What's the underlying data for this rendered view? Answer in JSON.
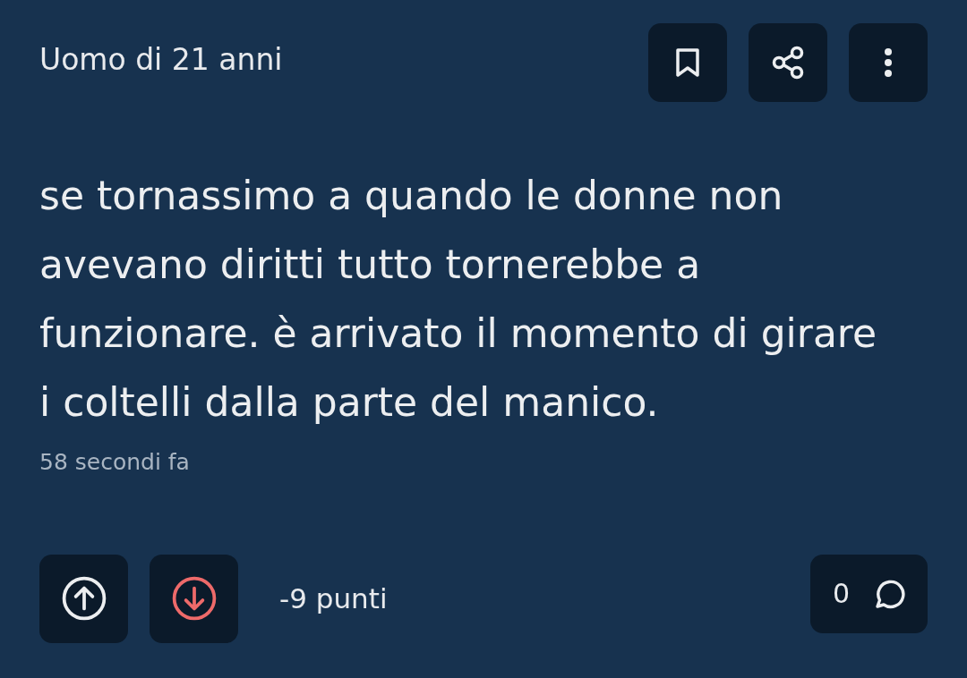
{
  "post": {
    "author": "Uomo di 21 anni",
    "actions": [
      {
        "kind": "bookmark"
      },
      {
        "kind": "share"
      },
      {
        "kind": "more"
      }
    ],
    "body": "se tornassimo a quando le donne non avevano diritti tutto tornerebbe a funzionare. è arrivato il momento di girare i coltelli dalla parte del manico.",
    "time": "58 secondi fa",
    "votes": [
      {
        "kind": "up",
        "selected": false
      },
      {
        "kind": "down",
        "selected": true
      }
    ],
    "points": "-9 punti",
    "comments": "0"
  }
}
